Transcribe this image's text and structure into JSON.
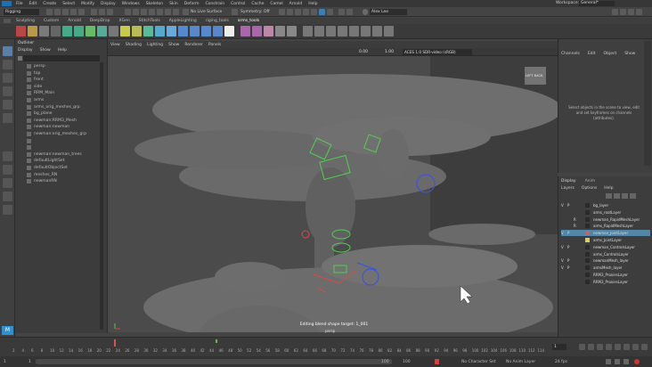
{
  "menubar": {
    "items": [
      "File",
      "Edit",
      "Create",
      "Select",
      "Modify",
      "Display",
      "Windows",
      "Skeleton",
      "Skin",
      "Deform",
      "Constrain",
      "Control",
      "Cache",
      "Camel",
      "Arnold",
      "Help"
    ],
    "workspace_label": "Workspace:",
    "workspace_value": "General*"
  },
  "status": {
    "mode": "Rigging",
    "live_surface": "No Live Surface",
    "symmetry": "Symmetry: Off",
    "user": "Alex Lee"
  },
  "shelf": {
    "tabs": [
      "Sculpting",
      "Custom",
      "Arnold",
      "DeepDrop",
      "XGen",
      "StitchTools",
      "AppleLighting",
      "riging_tools",
      "arms_tools"
    ],
    "active_index": 8
  },
  "outliner": {
    "title": "Outliner",
    "menu": [
      "Display",
      "Show",
      "Help"
    ],
    "rows": [
      "persp",
      "top",
      "front",
      "side",
      "RRM_Main",
      "arms",
      "arms_orig_meshes_grp",
      "bg_plane",
      "newman:RRM3_Mesh",
      "newman:newman",
      "newman:orig_meshes_grp",
      "",
      "",
      "newman:newman_trees",
      "defaultLightSet",
      "defaultObjectSet",
      "meshes_RN",
      "newmanRN"
    ]
  },
  "viewport": {
    "menu": [
      "View",
      "Shading",
      "Lighting",
      "Show",
      "Renderer",
      "Panels"
    ],
    "exposure": "0.00",
    "gamma": "1.00",
    "color_space": "ACES 1.0 SDR-video (sRGB)",
    "caption": "Editing blend shape target: 1_001",
    "caption2": "persp",
    "nav_cube": "LEFT  BACK"
  },
  "channel_box": {
    "menu": [
      "Channels",
      "Edit",
      "Object",
      "Show"
    ],
    "hint": "Select objects in the scene to view, edit and set keyframes on channels (attributes)."
  },
  "layers": {
    "tabs": [
      "Display",
      "Anim"
    ],
    "menu": [
      "Layers",
      "Options",
      "Help"
    ],
    "rows": [
      {
        "v": "V",
        "p": "P",
        "r": "",
        "name": "bg_layer",
        "color": "#2a2a2a"
      },
      {
        "v": "",
        "p": "",
        "r": "",
        "name": "arms_rootLayer",
        "color": "#2a2a2a"
      },
      {
        "v": "",
        "p": "",
        "r": "R",
        "name": "newman_RapidMeshLayer",
        "color": "#2a2a2a"
      },
      {
        "v": "",
        "p": "",
        "r": "R",
        "name": "arms_RapidMeshLayer",
        "color": "#2a2a2a"
      },
      {
        "v": "V",
        "p": "P",
        "r": "",
        "name": "newman_JointLayer",
        "color": "#d06060",
        "selected": true
      },
      {
        "v": "",
        "p": "",
        "r": "",
        "name": "arms_JointLayer",
        "color": "#d9d050"
      },
      {
        "v": "V",
        "p": "P",
        "r": "",
        "name": "newman_ControlsLayer",
        "color": "#2a2a2a"
      },
      {
        "v": "",
        "p": "",
        "r": "",
        "name": "arms_ControlsLayer",
        "color": "#2a2a2a"
      },
      {
        "v": "V",
        "p": "P",
        "r": "",
        "name": "newmanMesh_layer",
        "color": "#2a2a2a"
      },
      {
        "v": "V",
        "p": "P",
        "r": "",
        "name": "armsMesh_layer",
        "color": "#2a2a2a"
      },
      {
        "v": "",
        "p": "",
        "r": "",
        "name": "RRM3_ProxiesLayer",
        "color": "#2a2a2a"
      },
      {
        "v": "",
        "p": "",
        "r": "",
        "name": "RRM3_ProxiesLayer",
        "color": "#2a2a2a"
      }
    ]
  },
  "timeline": {
    "ticks": [
      "2",
      "4",
      "6",
      "8",
      "10",
      "12",
      "14",
      "16",
      "18",
      "20",
      "22",
      "24",
      "26",
      "28",
      "30",
      "32",
      "34",
      "36",
      "38",
      "40",
      "42",
      "44",
      "46",
      "48",
      "50",
      "52",
      "54",
      "56",
      "58",
      "60",
      "62",
      "64",
      "66",
      "68",
      "70",
      "72",
      "74",
      "76",
      "78",
      "80",
      "82",
      "84",
      "86",
      "88",
      "90",
      "92",
      "94",
      "96",
      "98",
      "100",
      "102",
      "104",
      "106",
      "108",
      "110",
      "112",
      "114"
    ],
    "current_frame": "1",
    "range_start": "1",
    "range_start2": "1",
    "range_end": "100",
    "range_end2": "100",
    "character_set": "No Character Set",
    "anim_layer": "No Anim Layer",
    "fps": "24 fps"
  }
}
